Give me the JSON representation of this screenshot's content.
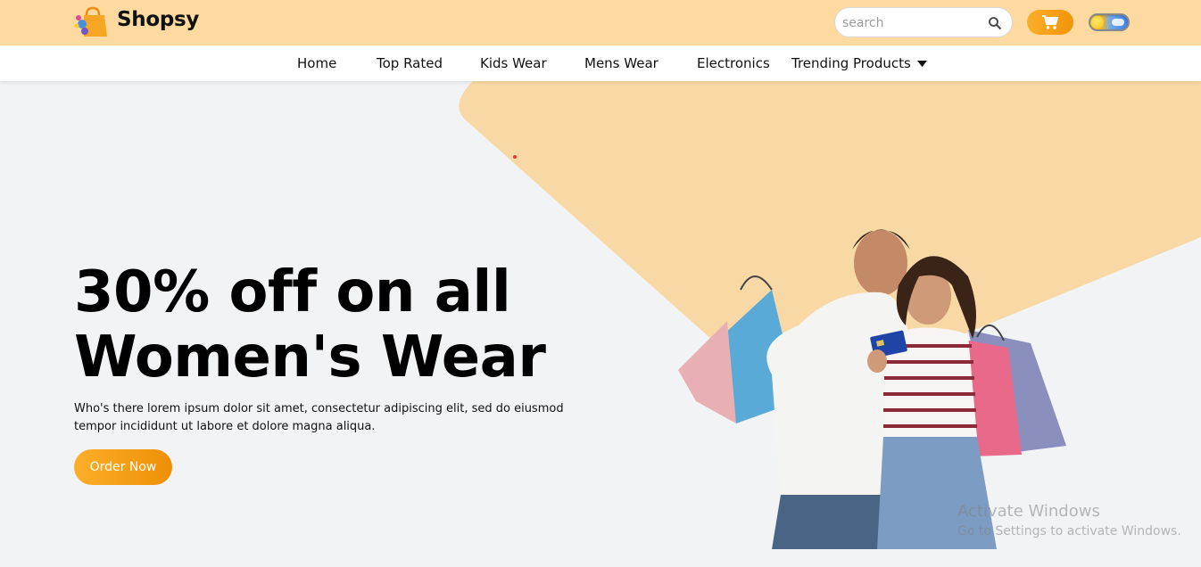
{
  "header": {
    "brand": "Shopsy",
    "logo_icon": "shopping-bag-icon",
    "search": {
      "placeholder": "search",
      "value": ""
    },
    "search_icon": "search-icon",
    "cart_icon": "cart-icon",
    "theme_toggle_icon": "day-night-toggle-icon"
  },
  "nav": {
    "items": [
      {
        "label": "Home"
      },
      {
        "label": "Top Rated"
      },
      {
        "label": "Kids Wear"
      },
      {
        "label": "Mens Wear"
      },
      {
        "label": "Electronics"
      },
      {
        "label": "Trending Products",
        "icon": "caret-down-icon"
      }
    ]
  },
  "hero": {
    "title": "30% off on all Women's Wear",
    "description": "Who's there lorem ipsum dolor sit amet, consectetur adipiscing elit, sed do eiusmod tempor incididunt ut labore et dolore magna aliqua.",
    "cta_label": "Order Now",
    "image": "couple-with-shopping-bags-image"
  },
  "overlay": {
    "title": "Activate Windows",
    "subtitle": "Go to Settings to activate Windows."
  },
  "colors": {
    "topbar_bg": "#fedaa0",
    "accent": "#f7a51c",
    "hero_bg": "#f2f3f5",
    "hero_shape": "#f8d8a4"
  }
}
